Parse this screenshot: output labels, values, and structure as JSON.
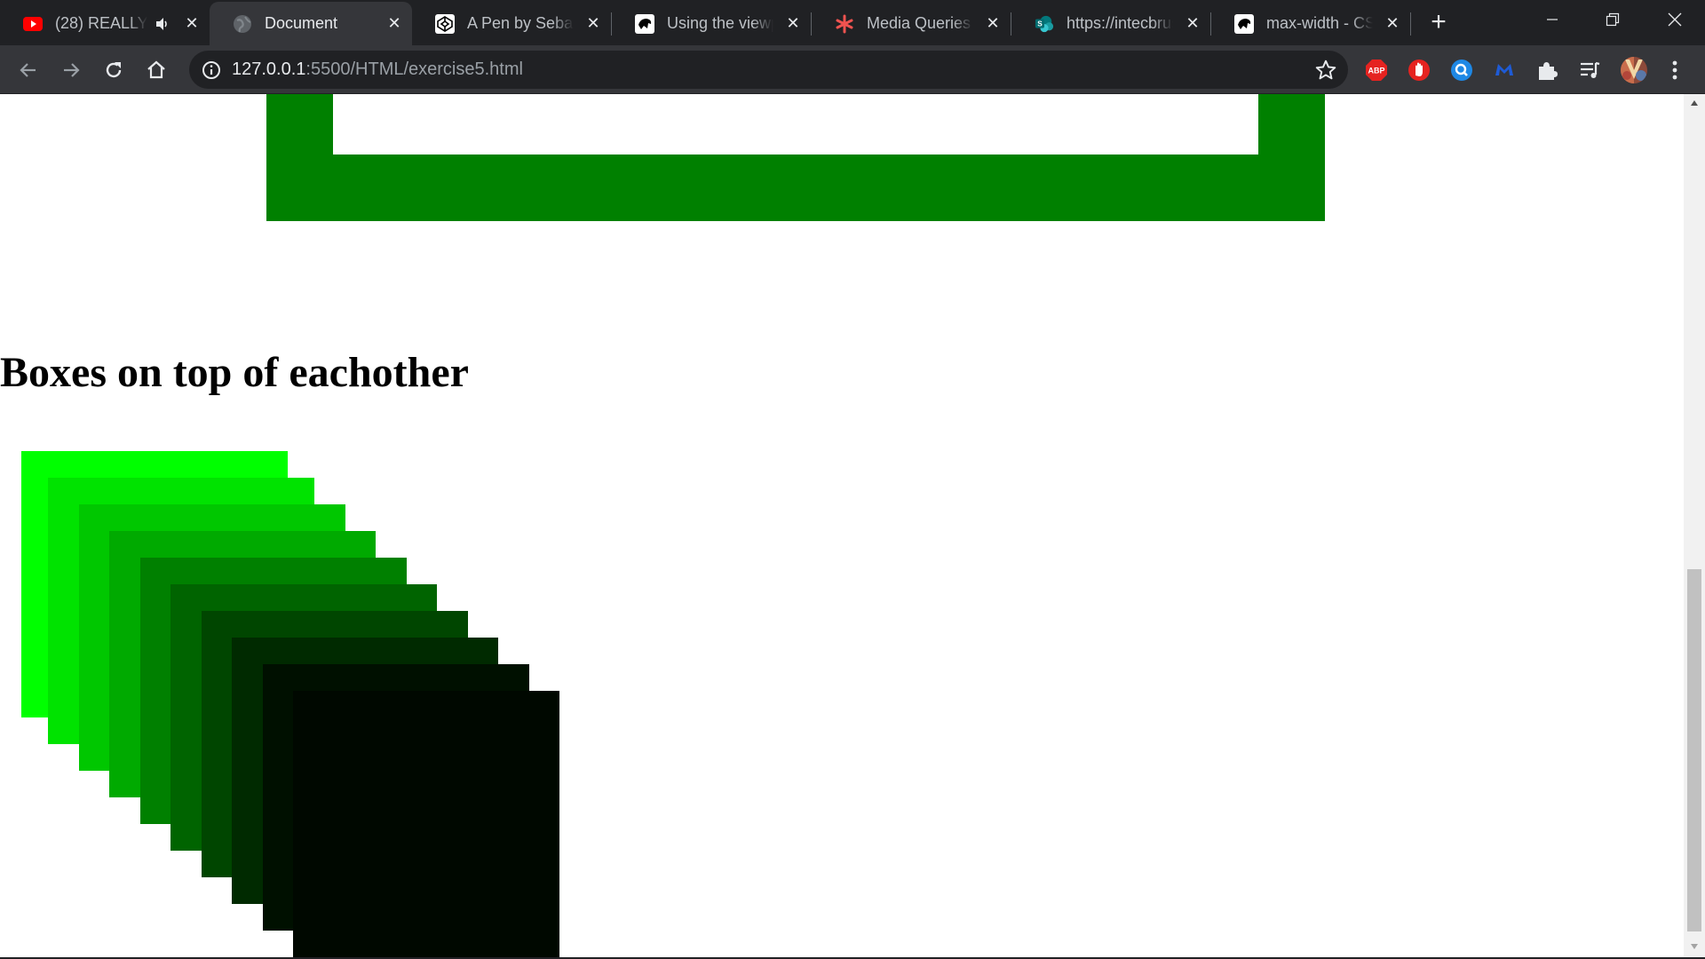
{
  "browser": {
    "tabs": [
      {
        "title": "(28) REALLY",
        "favicon": "youtube-icon",
        "audio": true,
        "active": false
      },
      {
        "title": "Document",
        "favicon": "globe-icon",
        "audio": false,
        "active": true
      },
      {
        "title": "A Pen by Sebastian",
        "favicon": "codepen-icon",
        "audio": false,
        "active": false
      },
      {
        "title": "Using the viewport",
        "favicon": "mdn-icon",
        "audio": false,
        "active": false
      },
      {
        "title": "Media Queries for",
        "favicon": "asterisk-icon",
        "audio": false,
        "active": false
      },
      {
        "title": "https://intecbrussel",
        "favicon": "sharepoint-icon",
        "audio": false,
        "active": false
      },
      {
        "title": "max-width - CSS",
        "favicon": "mdn-icon",
        "audio": false,
        "active": false
      }
    ],
    "address_bar": {
      "host": "127.0.0.1",
      "path": ":5500/HTML/exercise5.html"
    },
    "extensions": [
      "adblock-plus-icon",
      "hand-stop-icon",
      "search-circle-icon",
      "malwarebytes-icon",
      "extensions-puzzle-icon",
      "reading-list-icon",
      "profile-avatar"
    ],
    "extension_labels": {
      "adblock": "ABP"
    }
  },
  "page": {
    "heading": "Boxes on top of eachother",
    "frame_color": "#008000",
    "stacked_boxes": {
      "count": 10,
      "colors": [
        "#00ff00",
        "#00e300",
        "#00c700",
        "#00aa00",
        "#008000",
        "#006400",
        "#004600",
        "#002a00",
        "#001000",
        "#000800"
      ]
    }
  },
  "colors": {
    "tabstrip": "#202124",
    "toolbar": "#35363a",
    "omnibox": "#202124"
  }
}
